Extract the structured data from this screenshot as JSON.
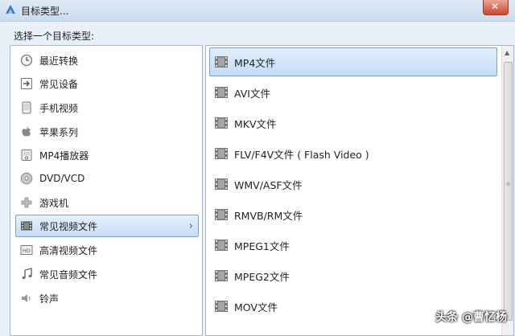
{
  "window": {
    "title": "目标类型..."
  },
  "prompt": "选择一个目标类型:",
  "categories": [
    {
      "label": "最近转换",
      "icon": "clock-icon"
    },
    {
      "label": "常见设备",
      "icon": "arrow-right-box-icon"
    },
    {
      "label": "手机视频",
      "icon": "phone-icon"
    },
    {
      "label": "苹果系列",
      "icon": "apple-icon"
    },
    {
      "label": "MP4播放器",
      "icon": "mp4-player-icon"
    },
    {
      "label": "DVD/VCD",
      "icon": "disc-icon"
    },
    {
      "label": "游戏机",
      "icon": "gamepad-icon"
    },
    {
      "label": "常见视频文件",
      "icon": "film-icon"
    },
    {
      "label": "高清视频文件",
      "icon": "hd-icon"
    },
    {
      "label": "常见音频文件",
      "icon": "music-note-icon"
    },
    {
      "label": "铃声",
      "icon": "ringtone-icon"
    }
  ],
  "selected_category": "常见视频文件",
  "formats": [
    {
      "label": "MP4文件"
    },
    {
      "label": "AVI文件"
    },
    {
      "label": "MKV文件"
    },
    {
      "label": "FLV/F4V文件 ( Flash Video )"
    },
    {
      "label": "WMV/ASF文件"
    },
    {
      "label": "RMVB/RM文件"
    },
    {
      "label": "MPEG1文件"
    },
    {
      "label": "MPEG2文件"
    },
    {
      "label": "MOV文件"
    }
  ],
  "selected_format": "MP4文件",
  "watermark": "头条 @曹忆杨",
  "colors": {
    "selection": "#c7def7",
    "selection_border": "#7da2ce"
  }
}
